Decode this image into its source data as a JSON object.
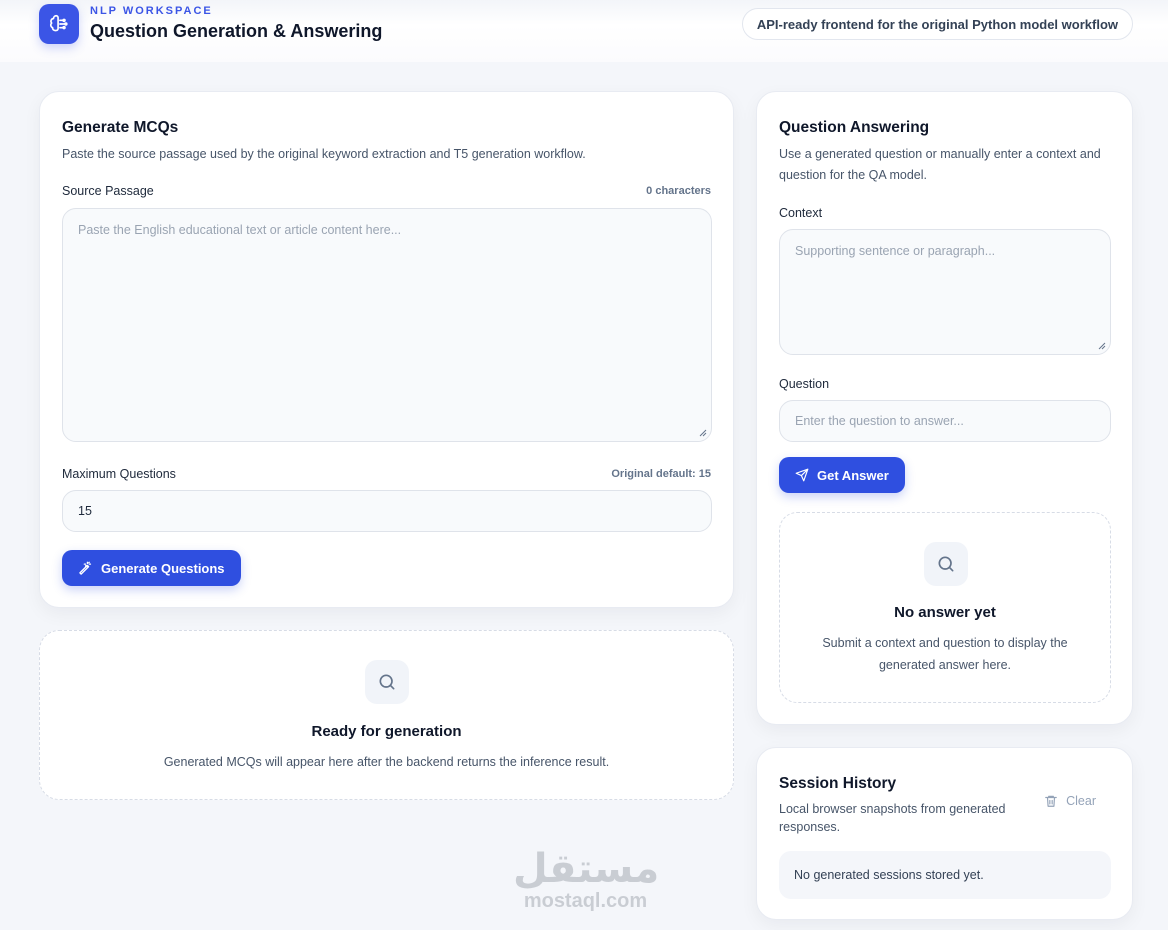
{
  "header": {
    "eyebrow": "NLP WORKSPACE",
    "title": "Question Generation & Answering",
    "pill": "API-ready frontend for the original Python model workflow"
  },
  "generate": {
    "title": "Generate MCQs",
    "description": "Paste the source passage used by the original keyword extraction and T5 generation workflow.",
    "source_label": "Source Passage",
    "char_count": "0 characters",
    "source_placeholder": "Paste the English educational text or article content here...",
    "max_label": "Maximum Questions",
    "max_hint": "Original default: 15",
    "max_value": "15",
    "button": "Generate Questions"
  },
  "results": {
    "title": "Ready for generation",
    "description": "Generated MCQs will appear here after the backend returns the inference result."
  },
  "qa": {
    "title": "Question Answering",
    "description": "Use a generated question or manually enter a context and question for the QA model.",
    "context_label": "Context",
    "context_placeholder": "Supporting sentence or paragraph...",
    "question_label": "Question",
    "question_placeholder": "Enter the question to answer...",
    "button": "Get Answer",
    "empty_title": "No answer yet",
    "empty_description": "Submit a context and question to display the generated answer here."
  },
  "history": {
    "title": "Session History",
    "description": "Local browser snapshots from generated responses.",
    "clear": "Clear",
    "empty": "No generated sessions stored yet."
  },
  "watermark": {
    "arabic": "مستقل",
    "latin": "mostaql.com"
  },
  "colors": {
    "accent": "#2f4fe0",
    "background": "#f4f6fa"
  },
  "icons": [
    "brain-icon",
    "magic-wand-icon",
    "search-icon",
    "send-icon",
    "trash-icon"
  ]
}
